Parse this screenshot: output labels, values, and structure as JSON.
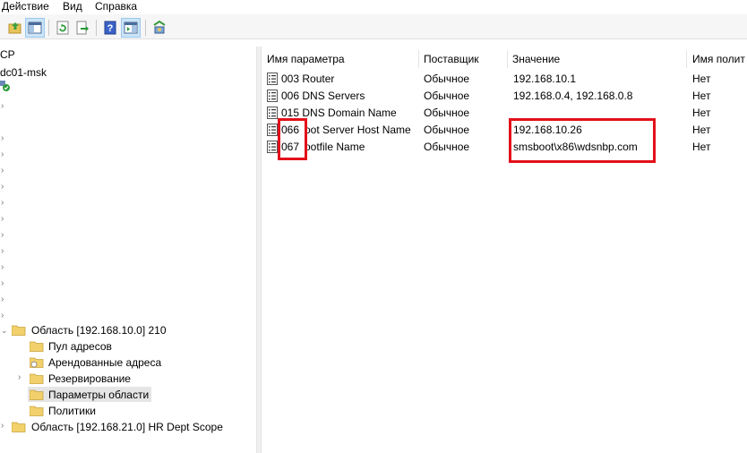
{
  "menu": {
    "items": [
      {
        "label": "Действие"
      },
      {
        "label": "Вид"
      },
      {
        "label": "Справка"
      }
    ]
  },
  "toolbar": {
    "icons": [
      "up-folder-icon",
      "show-hide-tree-icon",
      "refresh-icon",
      "export-list-icon",
      "help-icon",
      "show-hide-action-pane-icon",
      "dhcp-tool-icon"
    ]
  },
  "tree": {
    "root_label": "CP",
    "server_label": "dc01-msk",
    "scope_label": "Область [192.168.10.0] 210",
    "children": [
      {
        "label": "Пул адресов"
      },
      {
        "label": "Арендованные адреса"
      },
      {
        "label": "Резервирование"
      },
      {
        "label": "Параметры области"
      },
      {
        "label": "Политики"
      }
    ],
    "scope2_label": "Область [192.168.21.0] HR Dept Scope"
  },
  "list": {
    "columns": [
      {
        "label": "Имя параметра"
      },
      {
        "label": "Поставщик"
      },
      {
        "label": "Значение"
      },
      {
        "label": "Имя полит"
      }
    ],
    "rows": [
      {
        "name": "003 Router",
        "vendor": "Обычное",
        "value": "192.168.10.1",
        "policy": "Нет"
      },
      {
        "name": "006 DNS Servers",
        "vendor": "Обычное",
        "value": "192.168.0.4, 192.168.0.8",
        "policy": "Нет"
      },
      {
        "name": "015 DNS Domain Name",
        "vendor": "Обычное",
        "value": "",
        "policy": "Нет"
      },
      {
        "name_code": "066",
        "name_rest": "oot Server Host Name",
        "vendor": "Обычное",
        "value": "192.168.10.26",
        "policy": "Нет"
      },
      {
        "name_code": "067",
        "name_rest": "ootfile Name",
        "vendor": "Обычное",
        "value": "smsboot\\x86\\wdsnbp.com",
        "policy": "Нет"
      }
    ]
  },
  "colors": {
    "highlight": "#e3101a",
    "selection": "#e5e5e5",
    "toolbar_active": "#cce4f7"
  }
}
